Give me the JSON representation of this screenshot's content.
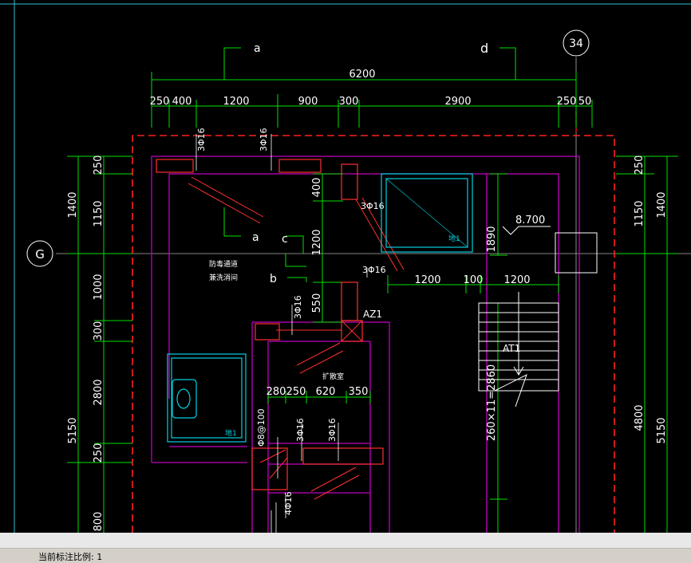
{
  "axis": {
    "top": "34",
    "left": "G"
  },
  "section_marks": {
    "a": "a",
    "d": "d",
    "c": "c",
    "b": "b"
  },
  "dims_top": {
    "overall": "6200",
    "parts": [
      "250",
      "400",
      "1200",
      "900",
      "300",
      "2900",
      "250",
      "50"
    ]
  },
  "dims_left_inner": [
    "250",
    "1150",
    "1000",
    "300",
    "2800",
    "250",
    "800"
  ],
  "dims_left_outer": [
    "1400",
    "5150"
  ],
  "dims_right_inner": [
    "250",
    "1150",
    "4800"
  ],
  "dims_right_outer": [
    "1400",
    "5150"
  ],
  "dims_mid_vertical": [
    "400",
    "1200",
    "550"
  ],
  "dims_mid": [
    "1200",
    "100",
    "1200"
  ],
  "dims_room": [
    "280",
    "250",
    "620",
    "350"
  ],
  "dim_1890": "1890",
  "stair_dim": "260×11=2860",
  "elevation": "8.700",
  "rebar": {
    "r1": "3Φ16",
    "r2": "3Φ16",
    "r3": "3Φ16",
    "r4": "3Φ16",
    "r5": "3Φ16",
    "r6": "3Φ16",
    "r7": "3Φ16",
    "r8": "Φ8@100",
    "r9": "4Φ16"
  },
  "tags": {
    "az1": "AZ1",
    "at1": "AT1"
  },
  "rooms": {
    "r1a": "防毒通道",
    "r1b": "兼洗消间",
    "r2": "扩散室"
  },
  "fixture_tags": {
    "f1": "地1",
    "f2": "地1"
  },
  "status": {
    "label": "当前标注比例: 1"
  },
  "colors": {
    "background": "#000000",
    "wall": "#c000c0",
    "dim_line": "#00ff00",
    "rebar": "#ff3030",
    "axis": "#ffffff",
    "fixture": "#00d0e0",
    "dashed": "#ff2020"
  }
}
